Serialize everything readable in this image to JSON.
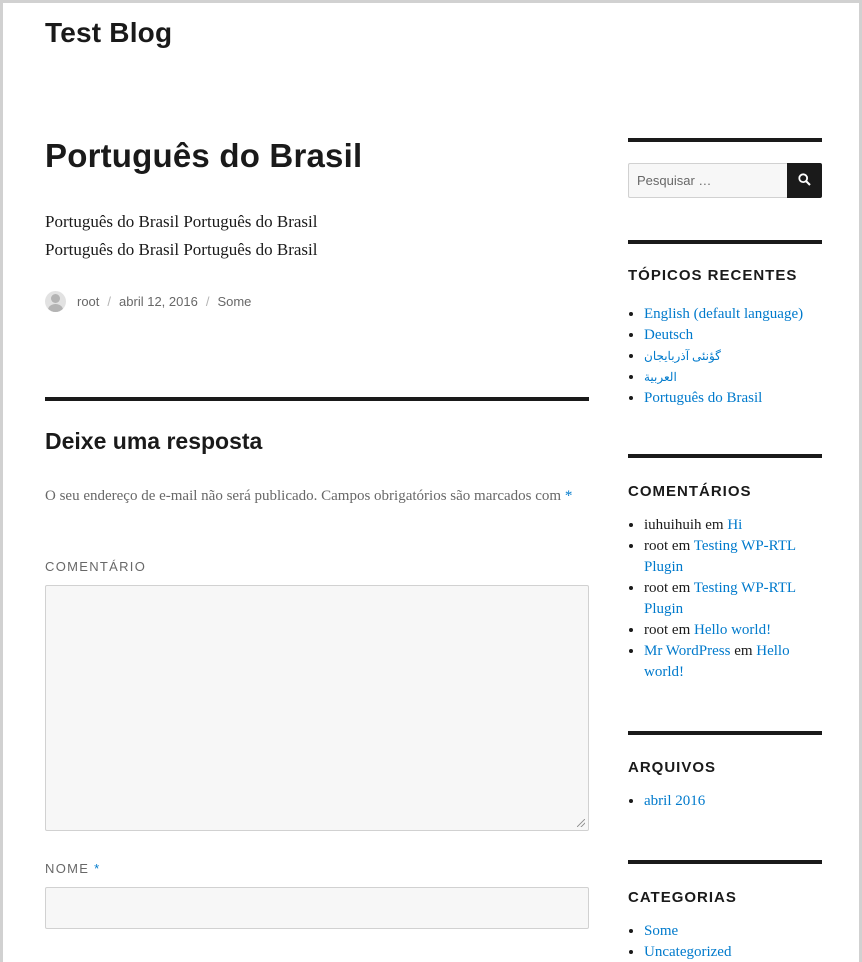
{
  "site": {
    "title": "Test Blog"
  },
  "post": {
    "title": "Português do Brasil",
    "content_line1": "Português do Brasil Português do Brasil",
    "content_line2": "Português do Brasil Português do Brasil",
    "author": "root",
    "date": "abril 12, 2016",
    "category": "Some",
    "separator": "/"
  },
  "comment_form": {
    "title": "Deixe uma resposta",
    "notes": "O seu endereço de e-mail não será publicado. Campos obrigatórios são marcados com",
    "required_mark": "*",
    "comment_label": "COMENTÁRIO",
    "name_label": "NOME",
    "comment_value": "",
    "name_value": ""
  },
  "sidebar": {
    "search": {
      "placeholder": "Pesquisar …",
      "button_icon": "search-icon"
    },
    "recent_posts": {
      "title": "TÓPICOS RECENTES",
      "items": [
        "English (default language)",
        "Deutsch",
        "گؤنئی آذربایجان",
        "العربية",
        "Português do Brasil"
      ]
    },
    "comments": {
      "title": "COMENTÁRIOS",
      "connector": "em",
      "items": [
        {
          "author": "iuhuihuih",
          "post": "Hi"
        },
        {
          "author": "root",
          "post": "Testing WP-RTL Plugin"
        },
        {
          "author": "root",
          "post": "Testing WP-RTL Plugin"
        },
        {
          "author": "root",
          "post": "Hello world!"
        },
        {
          "author": "Mr WordPress",
          "post": "Hello world!"
        }
      ]
    },
    "archives": {
      "title": "ARQUIVOS",
      "items": [
        "abril 2016"
      ]
    },
    "categories": {
      "title": "CATEGORIAS",
      "items": [
        "Some",
        "Uncategorized"
      ]
    }
  },
  "colors": {
    "link": "#007acc",
    "text": "#1a1a1a",
    "muted": "#686868",
    "field_bg": "#f7f7f7"
  }
}
